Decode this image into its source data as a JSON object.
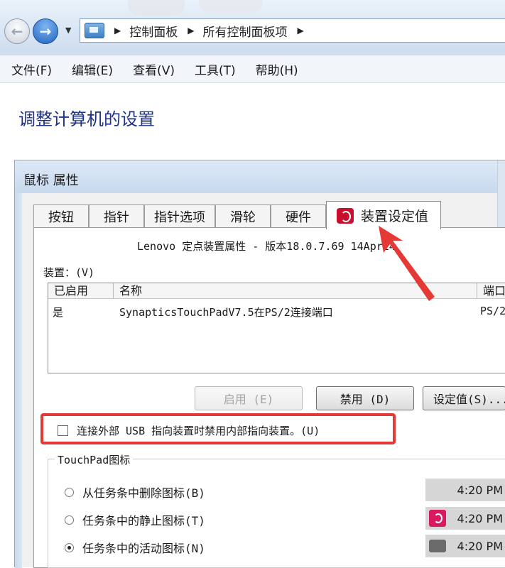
{
  "explorer": {
    "breadcrumb": [
      "控制面板",
      "所有控制面板项"
    ],
    "menu": [
      "文件(F)",
      "编辑(E)",
      "查看(V)",
      "工具(T)",
      "帮助(H)"
    ],
    "page_title": "调整计算机的设置"
  },
  "dialog": {
    "title": "鼠标 属性",
    "tabs": [
      "按钮",
      "指针",
      "指针选项",
      "滑轮",
      "硬件"
    ],
    "active_tab": "装置设定值",
    "header_line": "Lenovo 定点装置属性 - 版本18.0.7.69 14Apr14",
    "devices_label": "装置：(V)",
    "list": {
      "columns": [
        "已启用",
        "名称",
        "端口"
      ],
      "rows": [
        {
          "enabled": "是",
          "name": "SynapticsTouchPadV7.5在PS/2连接端口",
          "port": "PS/2"
        }
      ]
    },
    "buttons": {
      "enable": "启用 (E)",
      "disable": "禁用 (D)",
      "settings": "设定值(S)..."
    },
    "usb_checkbox": {
      "label": "连接外部 USB 指向装置时禁用内部指向装置。(U)",
      "checked": false
    },
    "touchpad_group": {
      "title": "TouchPad图标",
      "options": [
        "从任务条中删除图标(B)",
        "任务条中的静止图标(T)",
        "任务条中的活动图标(N)"
      ],
      "selected_index": 2,
      "preview_time": "4:20 PM"
    }
  },
  "colors": {
    "highlight": "#e53935",
    "lenovo_red": "#c8102e",
    "title_blue": "#1e3287"
  }
}
